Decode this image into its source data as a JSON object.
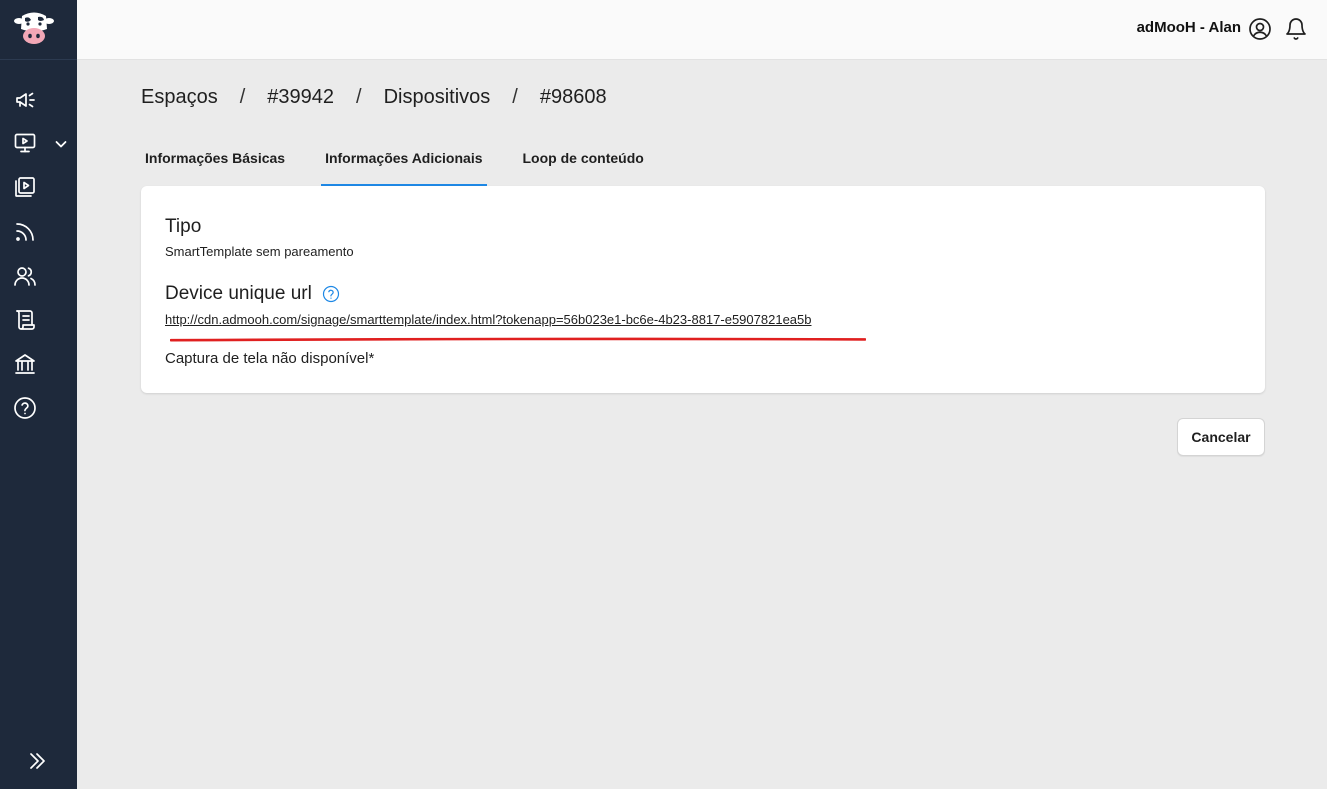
{
  "header": {
    "user_name": "adMooH - Alan"
  },
  "sidebar": {
    "items": [
      {
        "icon": "megaphone-icon"
      },
      {
        "icon": "monitor-play-icon"
      },
      {
        "icon": "media-library-icon"
      },
      {
        "icon": "rss-feed-icon"
      },
      {
        "icon": "users-icon"
      },
      {
        "icon": "scroll-icon"
      },
      {
        "icon": "bank-icon"
      },
      {
        "icon": "help-circle-icon"
      }
    ]
  },
  "breadcrumb": {
    "items": [
      "Espaços",
      "#39942",
      "Dispositivos",
      "#98608"
    ],
    "separator": "/"
  },
  "tabs": [
    {
      "label": "Informações Básicas",
      "active": false
    },
    {
      "label": "Informações Adicionais",
      "active": true
    },
    {
      "label": "Loop de conteúdo",
      "active": false
    }
  ],
  "card": {
    "tipo_title": "Tipo",
    "tipo_value": "SmartTemplate sem pareamento",
    "url_title": "Device unique url",
    "url_value": "http://cdn.admooh.com/signage/smarttemplate/index.html?tokenapp=56b023e1-bc6e-4b23-8817-e5907821ea5b",
    "capture_text": "Captura de tela não disponível*"
  },
  "actions": {
    "cancel_label": "Cancelar"
  },
  "colors": {
    "sidebar_bg": "#1e293b",
    "accent": "#1e88e5",
    "annotation_red": "#e02020"
  }
}
